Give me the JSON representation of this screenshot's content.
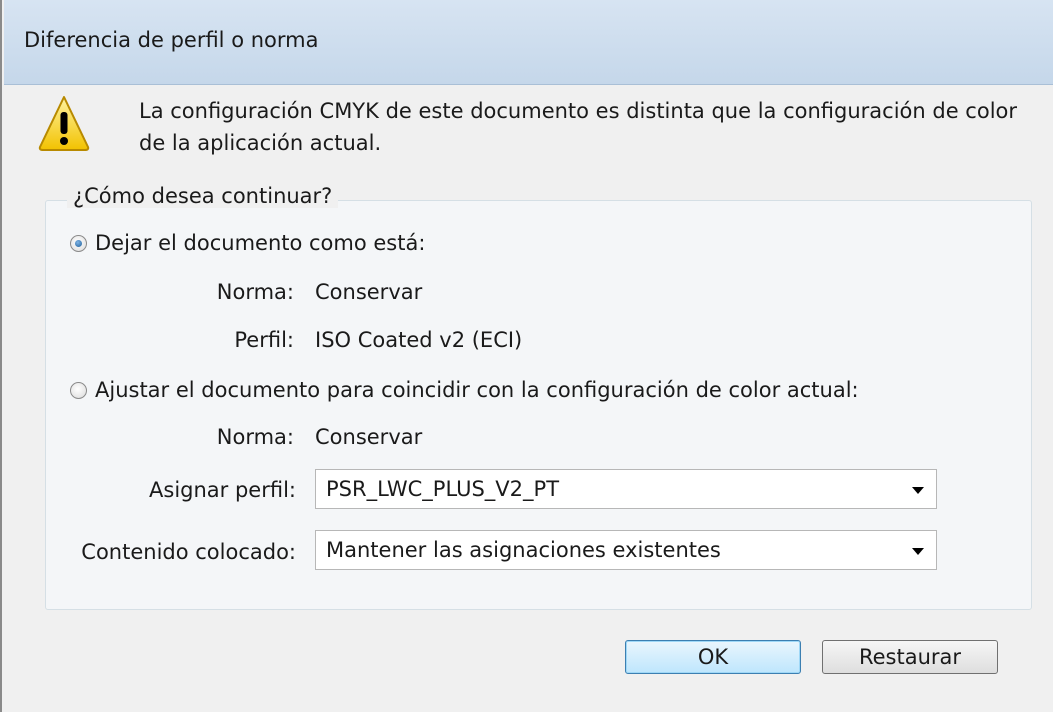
{
  "window": {
    "title": "Diferencia de perfil o norma"
  },
  "message": {
    "icon": "warning-icon",
    "text": "La configuración CMYK de este documento es distinta que la configuración de color de la aplicación actual."
  },
  "group": {
    "legend": "¿Cómo desea continuar?",
    "option_keep": {
      "label": "Dejar el documento como está:",
      "checked": true,
      "policy_label": "Norma:",
      "policy_value": "Conservar",
      "profile_label": "Perfil:",
      "profile_value": "ISO Coated v2 (ECI)"
    },
    "option_adjust": {
      "label": "Ajustar el documento para coincidir con la configuración de color actual:",
      "checked": false,
      "policy_label": "Norma:",
      "policy_value": "Conservar",
      "assign_profile_label": "Asignar perfil:",
      "assign_profile_value": "PSR_LWC_PLUS_V2_PT",
      "placed_content_label": "Contenido colocado:",
      "placed_content_value": "Mantener las asignaciones existentes"
    }
  },
  "buttons": {
    "ok": "OK",
    "reset": "Restaurar"
  },
  "colors": {
    "titlebar": "#c9dbee",
    "warning_yellow": "#f6d21c",
    "default_button": "#bee6fd"
  }
}
